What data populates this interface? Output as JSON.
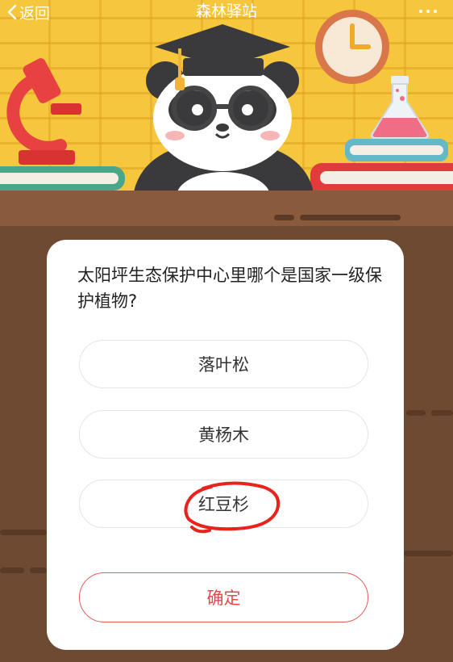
{
  "nav": {
    "back_label": "返回",
    "title": "森林驿站"
  },
  "quiz": {
    "question": "太阳坪生态保护中心里哪个是国家一级保护植物?",
    "options": [
      {
        "label": "落叶松"
      },
      {
        "label": "黄杨木"
      },
      {
        "label": "红豆杉"
      }
    ],
    "confirm_label": "确定",
    "circled_option_index": 2
  },
  "colors": {
    "header_bg": "#f6c63c",
    "desk": "#8a5a3c",
    "background": "#6e4a33",
    "card": "#ffffff",
    "confirm_accent": "#e04a4a",
    "annotation": "#e8231e"
  }
}
